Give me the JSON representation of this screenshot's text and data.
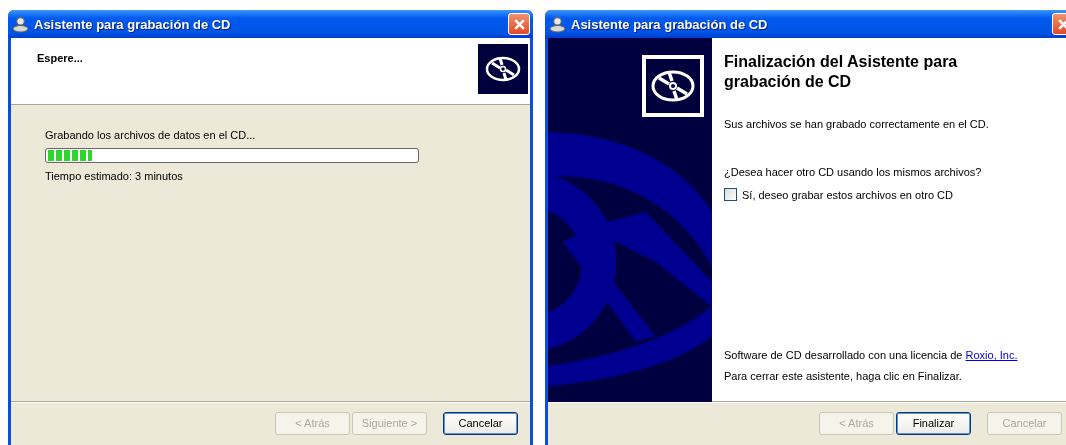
{
  "progress_window": {
    "title": "Asistente para grabación de CD",
    "header": "Espere...",
    "status": "Grabando los archivos de datos en el CD...",
    "progress": {
      "level": 0.12
    },
    "estimate": "Tiempo estimado: 3 minutos",
    "buttons": [
      {
        "label": "< Atrás",
        "disabled": true,
        "default": false
      },
      {
        "label": "Siguiente >",
        "disabled": true,
        "default": false
      },
      {
        "label": "Cancelar",
        "disabled": false,
        "default": true
      }
    ]
  },
  "finish_window": {
    "title": "Asistente para grabación de CD",
    "heading": "Finalización del Asistente para grabación de CD",
    "message": "Sus archivos se han grabado correctamente en el CD.",
    "question": "¿Desea hacer otro CD usando los mismos archivos?",
    "checkbox": {
      "label": "Sí, deseo grabar estos archivos en otro CD",
      "checked": false
    },
    "license": {
      "text": "Software de CD desarrollado con una licencia de",
      "link": "Roxio, Inc."
    },
    "close_hint": "Para cerrar este asistente, haga clic en Finalizar.",
    "buttons": [
      {
        "label": "< Atrás",
        "disabled": true,
        "default": false
      },
      {
        "label": "Finalizar",
        "disabled": false,
        "default": true
      },
      {
        "label": "Cancelar",
        "disabled": true,
        "default": false
      }
    ]
  }
}
